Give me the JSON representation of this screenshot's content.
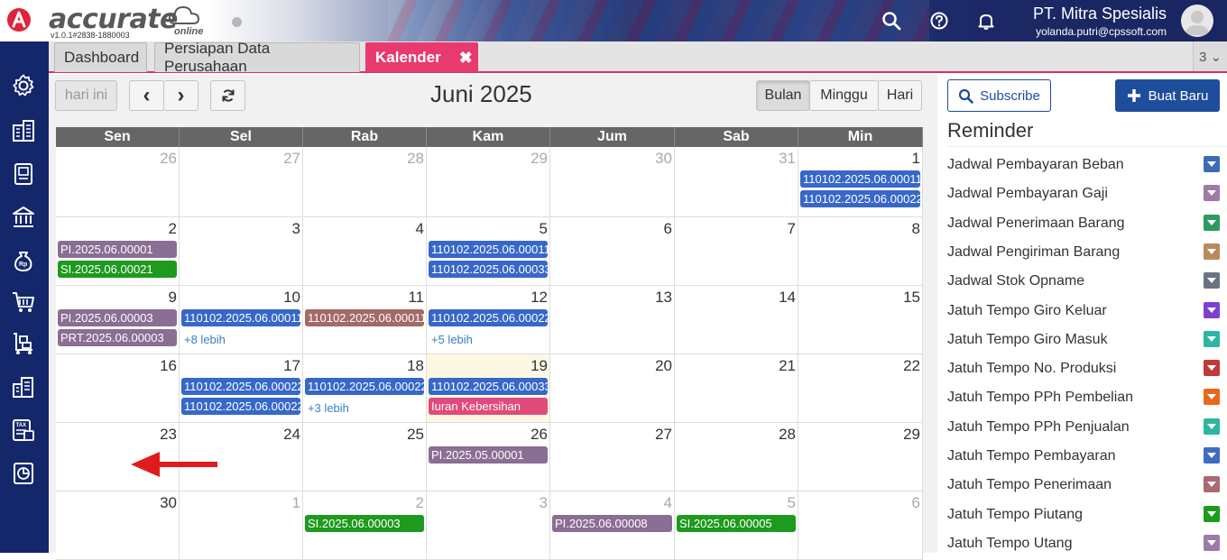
{
  "header": {
    "logo_text": "accurate",
    "logo_online": "online",
    "version": "v1.0.1#2838-1880003",
    "company_name": "PT. Mitra Spesialis",
    "user_email": "yolanda.putri@cpssoft.com"
  },
  "tabs": [
    {
      "label": "Dashboard"
    },
    {
      "label": "Persiapan Data Perusahaan"
    },
    {
      "label": "Kalender",
      "close": "✖"
    }
  ],
  "tab_count": "3 ⌄",
  "toolbar": {
    "today_label": "hari ini",
    "prev": "‹",
    "next": "›",
    "title": "Juni 2025",
    "view_month": "Bulan",
    "view_week": "Minggu",
    "view_day": "Hari"
  },
  "days_of_week": [
    "Sen",
    "Sel",
    "Rab",
    "Kam",
    "Jum",
    "Sab",
    "Min"
  ],
  "weeks": [
    {
      "days": [
        {
          "num": "26",
          "other": true,
          "events": []
        },
        {
          "num": "27",
          "other": true,
          "events": []
        },
        {
          "num": "28",
          "other": true,
          "events": []
        },
        {
          "num": "29",
          "other": true,
          "events": []
        },
        {
          "num": "30",
          "other": true,
          "events": []
        },
        {
          "num": "31",
          "other": true,
          "events": []
        },
        {
          "num": "1",
          "events": [
            {
              "text": "110102.2025.06.00011",
              "color": "#3768c8"
            },
            {
              "text": "110102.2025.06.00022",
              "color": "#3768c8"
            }
          ]
        }
      ]
    },
    {
      "days": [
        {
          "num": "2",
          "events": [
            {
              "text": "PI.2025.06.00001",
              "color": "#8a6e93"
            },
            {
              "text": "SI.2025.06.00021",
              "color": "#1e9a1e"
            }
          ]
        },
        {
          "num": "3",
          "events": []
        },
        {
          "num": "4",
          "events": []
        },
        {
          "num": "5",
          "events": [
            {
              "text": "110102.2025.06.00011",
              "color": "#3768c8"
            },
            {
              "text": "110102.2025.06.00033",
              "color": "#3768c8"
            }
          ]
        },
        {
          "num": "6",
          "events": []
        },
        {
          "num": "7",
          "events": []
        },
        {
          "num": "8",
          "events": []
        }
      ]
    },
    {
      "days": [
        {
          "num": "9",
          "events": [
            {
              "text": "PI.2025.06.00003",
              "color": "#8a6e93"
            },
            {
              "text": "PRT.2025.06.00003",
              "color": "#8a6e93"
            }
          ]
        },
        {
          "num": "10",
          "events": [
            {
              "text": "110102.2025.06.00011",
              "color": "#3768c8"
            }
          ],
          "more": "+8 lebih"
        },
        {
          "num": "11",
          "events": [
            {
              "text": "110102.2025.06.00011",
              "color": "#a36a66"
            }
          ]
        },
        {
          "num": "12",
          "events": [
            {
              "text": "110102.2025.06.00022",
              "color": "#3768c8"
            }
          ],
          "more": "+5 lebih"
        },
        {
          "num": "13",
          "events": []
        },
        {
          "num": "14",
          "events": []
        },
        {
          "num": "15",
          "events": []
        }
      ]
    },
    {
      "days": [
        {
          "num": "16",
          "events": []
        },
        {
          "num": "17",
          "events": [
            {
              "text": "110102.2025.06.00022",
              "color": "#3768c8"
            },
            {
              "text": "110102.2025.06.00022",
              "color": "#3768c8"
            }
          ]
        },
        {
          "num": "18",
          "events": [
            {
              "text": "110102.2025.06.00022",
              "color": "#3768c8"
            }
          ],
          "more": "+3 lebih"
        },
        {
          "num": "19",
          "today": true,
          "events": [
            {
              "text": "110102.2025.06.00033",
              "color": "#3768c8"
            },
            {
              "text": "Iuran Kebersihan",
              "color": "#e24a7b"
            }
          ]
        },
        {
          "num": "20",
          "events": []
        },
        {
          "num": "21",
          "events": []
        },
        {
          "num": "22",
          "events": []
        }
      ]
    },
    {
      "days": [
        {
          "num": "23",
          "events": []
        },
        {
          "num": "24",
          "events": []
        },
        {
          "num": "25",
          "events": []
        },
        {
          "num": "26",
          "events": [
            {
              "text": "PI.2025.05.00001",
              "color": "#8a6e93"
            }
          ]
        },
        {
          "num": "27",
          "events": []
        },
        {
          "num": "28",
          "events": []
        },
        {
          "num": "29",
          "events": []
        }
      ]
    },
    {
      "days": [
        {
          "num": "30",
          "events": []
        },
        {
          "num": "1",
          "other": true,
          "events": []
        },
        {
          "num": "2",
          "other": true,
          "events": [
            {
              "text": "SI.2025.06.00003",
              "color": "#1e9a1e"
            }
          ]
        },
        {
          "num": "3",
          "other": true,
          "events": []
        },
        {
          "num": "4",
          "other": true,
          "events": [
            {
              "text": "PI.2025.06.00008",
              "color": "#8a6e93"
            }
          ]
        },
        {
          "num": "5",
          "other": true,
          "events": [
            {
              "text": "SI.2025.06.00005",
              "color": "#1e9a1e"
            }
          ]
        },
        {
          "num": "6",
          "other": true,
          "events": []
        }
      ]
    }
  ],
  "right_panel": {
    "subscribe_label": "Subscribe",
    "new_label": "Buat Baru",
    "reminder_title": "Reminder",
    "reminders": [
      {
        "label": "Jadwal Pembayaran Beban",
        "color": "#3f6bb0"
      },
      {
        "label": "Jadwal Pembayaran Gaji",
        "color": "#9c7ba6"
      },
      {
        "label": "Jadwal Penerimaan Barang",
        "color": "#2e9a62"
      },
      {
        "label": "Jadwal Pengiriman Barang",
        "color": "#b88a5e"
      },
      {
        "label": "Jadwal Stok Opname",
        "color": "#6b7280"
      },
      {
        "label": "Jatuh Tempo Giro Keluar",
        "color": "#7c3fd1"
      },
      {
        "label": "Jatuh Tempo Giro Masuk",
        "color": "#2fb5a0"
      },
      {
        "label": "Jatuh Tempo No. Produksi",
        "color": "#c0393b"
      },
      {
        "label": "Jatuh Tempo PPh Pembelian",
        "color": "#e8681b"
      },
      {
        "label": "Jatuh Tempo PPh Penjualan",
        "color": "#2fb5a0"
      },
      {
        "label": "Jatuh Tempo Pembayaran",
        "color": "#3f6bc4"
      },
      {
        "label": "Jatuh Tempo Penerimaan",
        "color": "#a96a72"
      },
      {
        "label": "Jatuh Tempo Piutang",
        "color": "#1e9a1e"
      },
      {
        "label": "Jatuh Tempo Utang",
        "color": "#9c7ba6"
      }
    ]
  }
}
